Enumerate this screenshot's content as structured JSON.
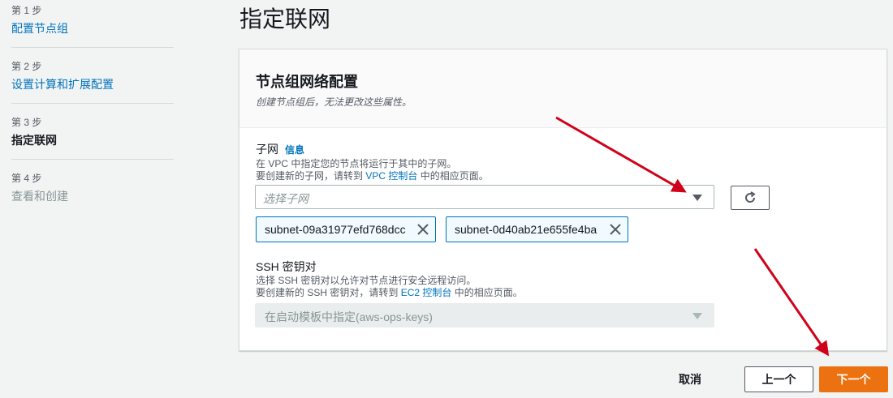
{
  "steps": [
    {
      "num": "第 1 步",
      "name": "配置节点组"
    },
    {
      "num": "第 2 步",
      "name": "设置计算和扩展配置"
    },
    {
      "num": "第 3 步",
      "name": "指定联网"
    },
    {
      "num": "第 4 步",
      "name": "查看和创建"
    }
  ],
  "page_title": "指定联网",
  "panel": {
    "title": "节点组网络配置",
    "description": "创建节点组后，无法更改这些属性。"
  },
  "subnet": {
    "label": "子网",
    "info": "信息",
    "desc_line1": "在 VPC 中指定您的节点将运行于其中的子网。",
    "desc_line2_prefix": "要创建新的子网，请转到 ",
    "desc_line2_link": "VPC 控制台",
    "desc_line2_suffix": " 中的相应页面。",
    "placeholder": "选择子网",
    "tokens": [
      "subnet-09a31977efd768dcc",
      "subnet-0d40ab21e655fe4ba"
    ]
  },
  "ssh": {
    "label": "SSH 密钥对",
    "desc_line1": "选择 SSH 密钥对以允许对节点进行安全远程访问。",
    "desc_line2_prefix": "要创建新的 SSH 密钥对，请转到 ",
    "desc_line2_link": "EC2 控制台",
    "desc_line2_suffix": " 中的相应页面。",
    "value": "在启动模板中指定(aws-ops-keys)"
  },
  "footer": {
    "cancel": "取消",
    "previous": "上一个",
    "next": "下一个"
  },
  "icons": {
    "refresh": "refresh-icon",
    "dropdown": "caret-down-icon",
    "remove": "close-icon",
    "annotation": "red-arrow"
  },
  "colors": {
    "link": "#0073bb",
    "primary": "#ec7211",
    "annotation": "#d0021b"
  }
}
